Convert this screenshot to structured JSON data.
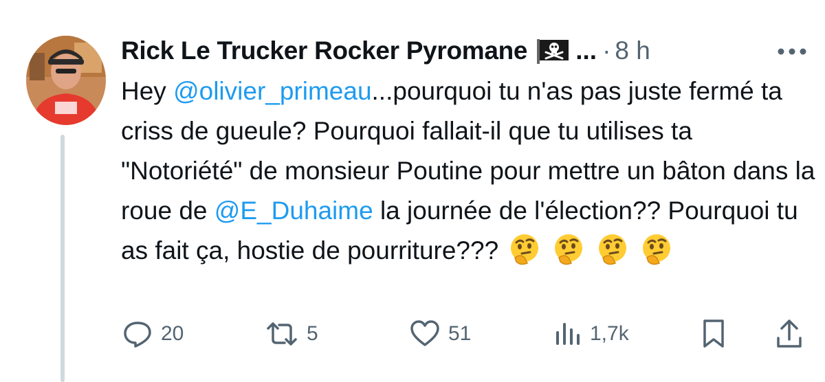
{
  "post": {
    "author_name": "Rick Le Trucker Rocker Pyromane",
    "name_truncation": "...",
    "separator": "·",
    "timestamp": "8 h",
    "text": {
      "part1": "Hey ",
      "mention1": "@olivier_primeau",
      "part2": "...pourquoi tu n'as pas juste fermé ta criss de gueule? Pourquoi fallait-il que tu utilises ta \"Notoriété\" de monsieur Poutine pour mettre un bâton dans la roue de ",
      "mention2": "@E_Duhaime",
      "part3": " la journée de l'élection?? Pourquoi tu as fait ça, hostie de pourriture???"
    },
    "emojis": [
      "thinking-face",
      "thinking-face",
      "thinking-face",
      "thinking-face"
    ]
  },
  "actions": {
    "replies": "20",
    "reposts": "5",
    "likes": "51",
    "views": "1,7k"
  },
  "icons": {
    "flag": "pirate-flag-icon",
    "more": "more-dots-icon",
    "reply": "reply-icon",
    "repost": "repost-icon",
    "like": "heart-icon",
    "views": "views-icon",
    "bookmark": "bookmark-icon",
    "share": "share-icon"
  },
  "colors": {
    "text": "#0f1419",
    "secondary": "#536471",
    "link": "#1d9bf0",
    "thread_line": "#cfd9de"
  }
}
